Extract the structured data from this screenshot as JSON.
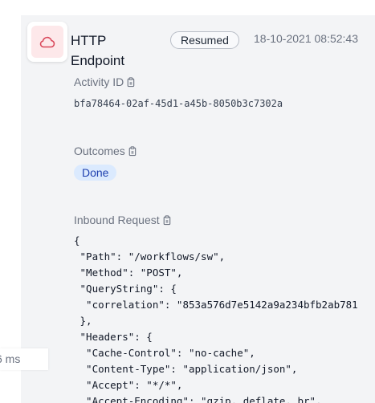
{
  "header": {
    "title": "HTTP Endpoint",
    "status": "Resumed",
    "timestamp": "18-10-2021 08:52:43",
    "icon": "cloud-icon",
    "icon_color": "#d9475a"
  },
  "activity": {
    "label": "Activity ID",
    "value": "bfa78464-02af-45d1-a45b-8050b3c7302a"
  },
  "outcomes": {
    "label": "Outcomes",
    "value": "Done"
  },
  "inbound": {
    "label": "Inbound Request",
    "body": "{\n \"Path\": \"/workflows/sw\",\n \"Method\": \"POST\",\n \"QueryString\": {\n  \"correlation\": \"853a576d7e5142a9a234bfb2ab781\n },\n \"Headers\": {\n  \"Cache-Control\": \"no-cache\",\n  \"Content-Type\": \"application/json\",\n  \"Accept\": \"*/*\",\n  \"Accept-Encoding\": \"gzip, deflate, br\","
  },
  "duration": "6 ms"
}
